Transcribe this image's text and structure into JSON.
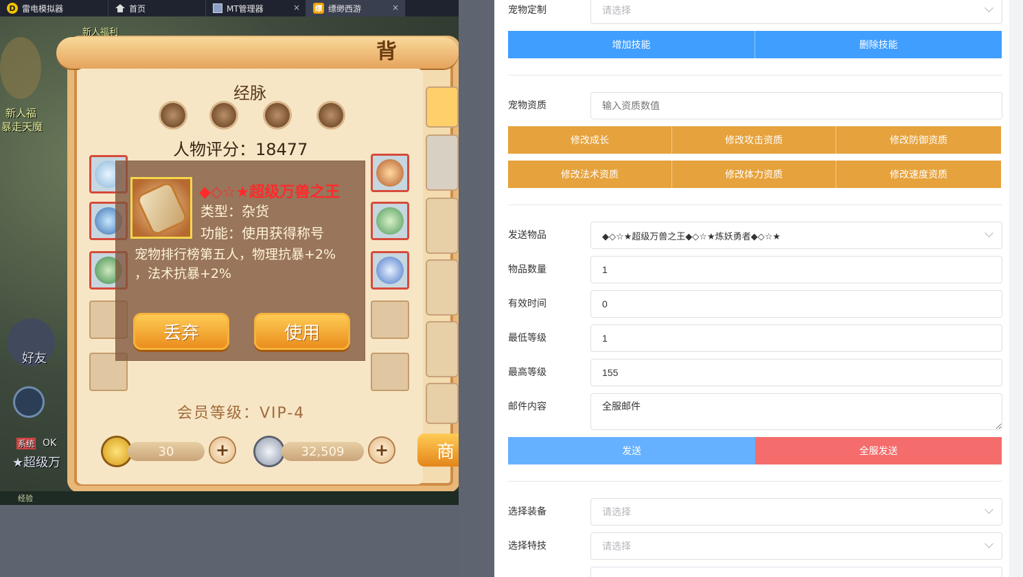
{
  "tabs": [
    {
      "label": "雷电模拟器",
      "icon": "emulator-logo-icon"
    },
    {
      "label": "首页",
      "icon": "home-icon"
    },
    {
      "label": "MT管理器",
      "icon": "mt-manager-icon",
      "close": "×"
    },
    {
      "label": "缥缈西游",
      "icon": "game-icon",
      "close": "×"
    }
  ],
  "game": {
    "panel_title": "背包",
    "meridian_label": "经脉",
    "score_text": "人物评分：18477",
    "vip_text": "会员等级：VIP-4",
    "sidebar": [
      "新人福利",
      "新人福",
      "暴走天魔",
      "好友",
      "系统",
      "OK",
      "★超级万",
      "经验"
    ],
    "tooltip": {
      "name": "◆◇☆★超级万兽之王",
      "type": "类型：杂货",
      "function": "功能：使用获得称号",
      "desc_line1": "宠物排行榜第五人，物理抗暴+2%",
      "desc_line2": "，法术抗暴+2%",
      "discard_label": "丢弃",
      "use_label": "使用"
    },
    "gold_amount": "30",
    "silver_amount": "32,509",
    "plus_label": "+",
    "shop_label": "商"
  },
  "form": {
    "pet_custom": {
      "label": "宠物定制",
      "placeholder": "请选择"
    },
    "add_skill_label": "增加技能",
    "delete_skill_label": "删除技能",
    "pet_aptitude": {
      "label": "宠物资质",
      "placeholder": "输入资质数值"
    },
    "aptitude_buttons": [
      "修改成长",
      "修改攻击资质",
      "修改防御资质",
      "修改法术资质",
      "修改体力资质",
      "修改速度资质"
    ],
    "send_item": {
      "label": "发送物品",
      "value": "◆◇☆★超级万兽之王◆◇☆★炼妖勇者◆◇☆★"
    },
    "item_qty": {
      "label": "物品数量",
      "value": "1"
    },
    "valid_time": {
      "label": "有效时间",
      "value": "0"
    },
    "min_level": {
      "label": "最低等级",
      "value": "1"
    },
    "max_level": {
      "label": "最高等级",
      "value": "155"
    },
    "mail_content": {
      "label": "邮件内容",
      "value": "全服邮件"
    },
    "send_label": "发送",
    "send_all_label": "全服发送",
    "select_equip": {
      "label": "选择装备",
      "placeholder": "请选择"
    },
    "select_skill": {
      "label": "选择特技",
      "placeholder": "请选择"
    }
  },
  "colors": {
    "primary": "#409eff",
    "warning": "#e6a23c",
    "danger": "#f56c6c",
    "item_name": "#ff2a2a"
  }
}
